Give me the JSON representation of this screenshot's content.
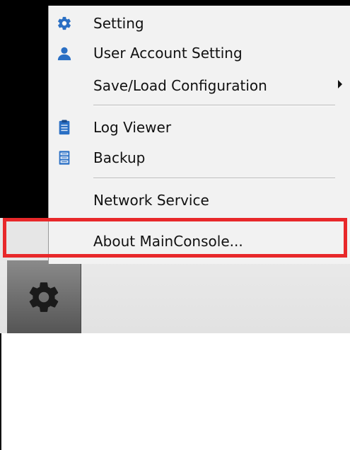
{
  "menu": {
    "items": [
      {
        "label": "Setting",
        "icon": "gear-icon"
      },
      {
        "label": "User Account Setting",
        "icon": "user-icon"
      },
      {
        "label": "Save/Load Configuration",
        "icon": "",
        "submenu": true
      },
      {
        "label": "Log Viewer",
        "icon": "clipboard-icon"
      },
      {
        "label": "Backup",
        "icon": "backup-icon"
      },
      {
        "label": "Network Service",
        "icon": ""
      },
      {
        "label": "About MainConsole...",
        "icon": "",
        "highlighted": true
      }
    ]
  },
  "colors": {
    "highlight_border": "#e8282a",
    "menu_background": "#f2f2f2",
    "icon_blue": "#2a6fc4"
  },
  "toolbar": {
    "settings_button_icon": "gear-icon"
  }
}
